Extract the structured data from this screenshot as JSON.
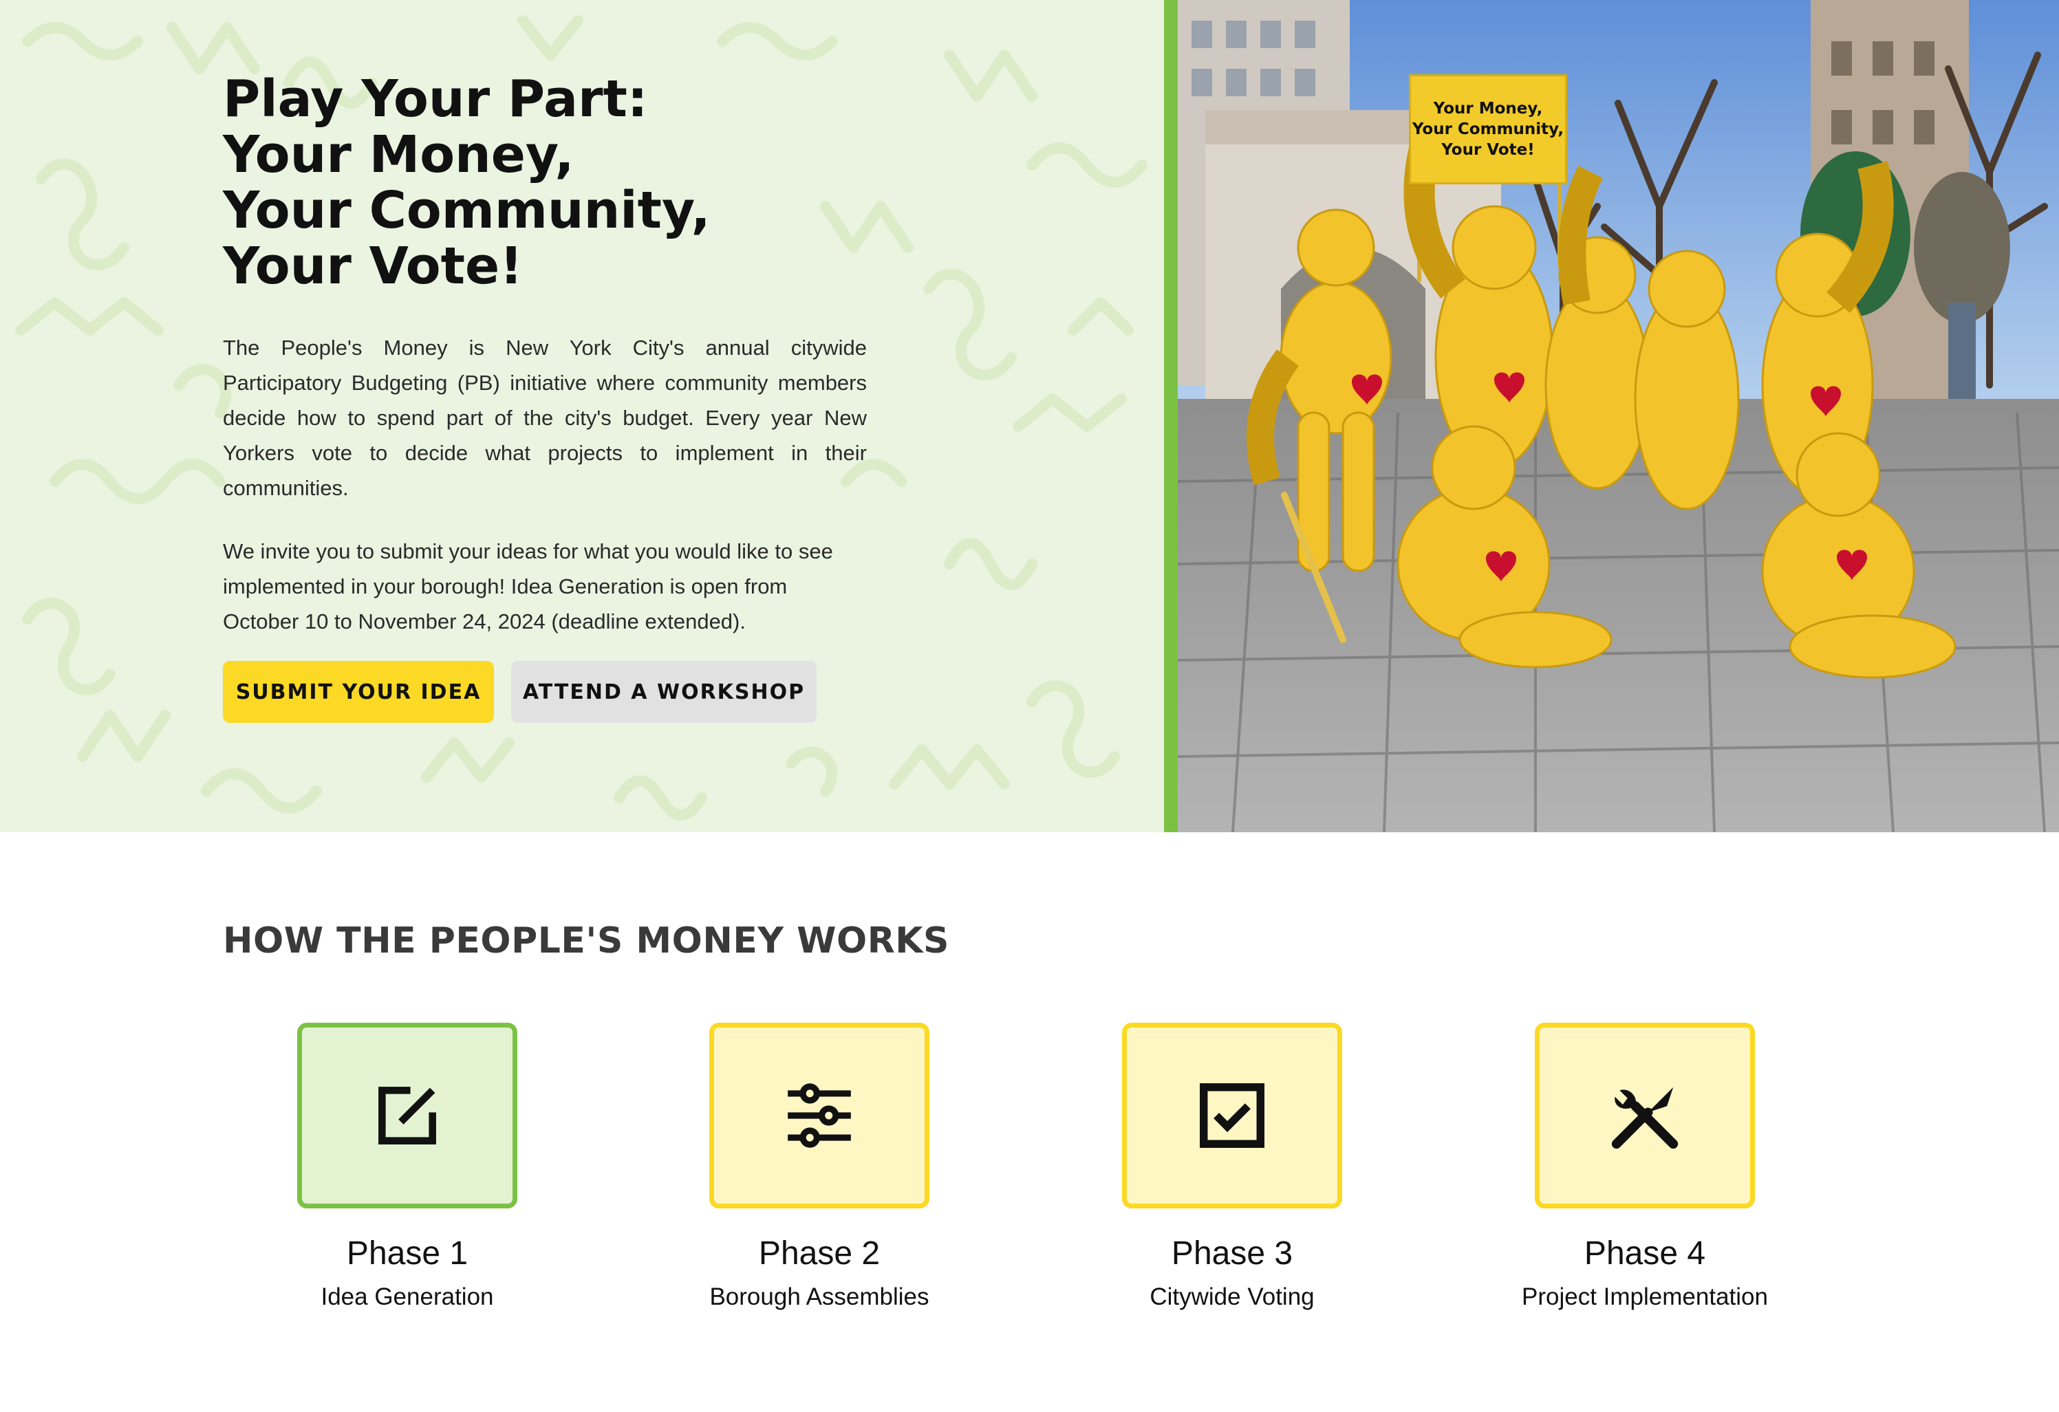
{
  "hero": {
    "title_lines": [
      "Play Your Part:",
      "Your Money,",
      "Your Community,",
      "Your Vote!"
    ],
    "paragraph_1": "The People's Money is New York City's annual citywide Participatory Budgeting (PB) initiative where community members decide how to spend part of the city's budget. Every year New Yorkers vote to decide what projects to implement in their communities.",
    "paragraph_2": "We invite you to submit your ideas for what you would like to see implemented in your borough! Idea Generation is open from October 10 to November 24, 2024 (deadline extended).",
    "primary_button": "SUBMIT YOUR IDEA",
    "secondary_button": "ATTEND A WORKSHOP",
    "sign_lines": [
      "Your Money,",
      "Your Community,",
      "Your Vote!"
    ]
  },
  "how": {
    "title": "HOW THE PEOPLE'S MONEY WORKS",
    "phases": [
      {
        "number": "Phase 1",
        "name": "Idea Generation",
        "icon": "edit-icon",
        "active": true
      },
      {
        "number": "Phase 2",
        "name": "Borough Assemblies",
        "icon": "sliders-icon",
        "active": false
      },
      {
        "number": "Phase 3",
        "name": "Citywide Voting",
        "icon": "checkbox-icon",
        "active": false
      },
      {
        "number": "Phase 4",
        "name": "Project Implementation",
        "icon": "tools-icon",
        "active": false
      }
    ]
  },
  "colors": {
    "hero_bg": "#eaf4e1",
    "green_accent": "#7bc244",
    "yellow_accent": "#fbd924",
    "secondary_button_bg": "#e1e1e1"
  }
}
